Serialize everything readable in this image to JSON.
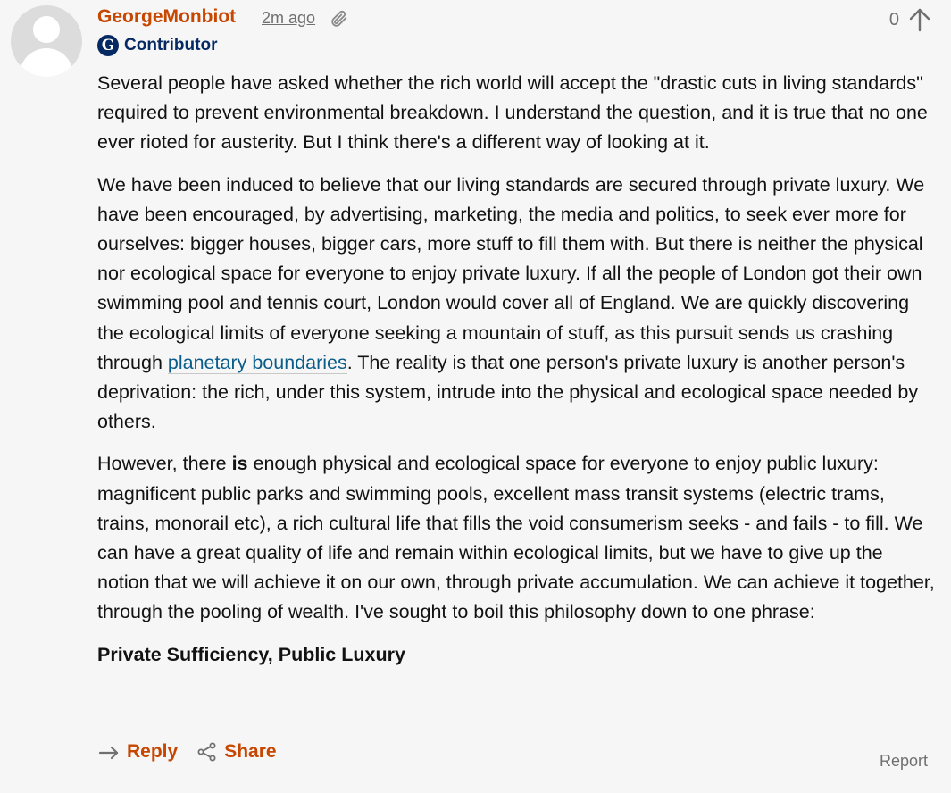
{
  "comment": {
    "author": "GeorgeMonbiot",
    "timestamp": "2m ago",
    "badge_label": "Contributor",
    "badge_letter": "G",
    "recommend_count": "0",
    "paragraphs": {
      "p1": "Several people have asked whether the rich world will accept the \"drastic cuts in living standards\" required to prevent environmental breakdown. I understand the question, and it is true that no one ever rioted for austerity. But I think there's a different way of looking at it.",
      "p2_before_link": "We have been induced to believe that our living standards are secured through private luxury. We have been encouraged, by advertising, marketing, the media and politics, to seek ever more for ourselves: bigger houses, bigger cars, more stuff to fill them with. But there is neither the physical nor ecological space for everyone to enjoy private luxury. If all the people of London got their own swimming pool and tennis court, London would cover all of England. We are quickly discovering the ecological limits of everyone seeking a mountain of stuff, as this pursuit sends us crashing through ",
      "p2_link": "planetary boundaries",
      "p2_after_link": ". The reality is that one person's private luxury is another person's deprivation: the rich, under this system, intrude into the physical and ecological space needed by others.",
      "p3_before_bold": "However, there ",
      "p3_bold": "is",
      "p3_after_bold": " enough physical and ecological space for everyone to enjoy public luxury: magnificent public parks and swimming pools, excellent mass transit systems (electric trams, trains, monorail etc), a rich cultural life that fills the void consumerism seeks - and fails - to fill. We can have a great quality of life and remain within ecological limits, but we have to give up the notion that we will achieve it on our own, through private accumulation. We can achieve it together, through the pooling of wealth. I've sought to boil this philosophy down to one phrase:",
      "p4": "Private Sufficiency, Public Luxury"
    },
    "actions": {
      "reply_label": "Reply",
      "share_label": "Share",
      "report_label": "Report"
    }
  },
  "icons": {
    "avatar": "default-avatar-icon",
    "link": "paperclip-icon",
    "recommend": "up-arrow-icon",
    "reply": "reply-arrow-icon",
    "share": "share-icon"
  },
  "colors": {
    "accent": "#c74600",
    "brand": "#052962",
    "link": "#0a5d8a",
    "muted": "#707070",
    "background": "#f6f6f6"
  }
}
